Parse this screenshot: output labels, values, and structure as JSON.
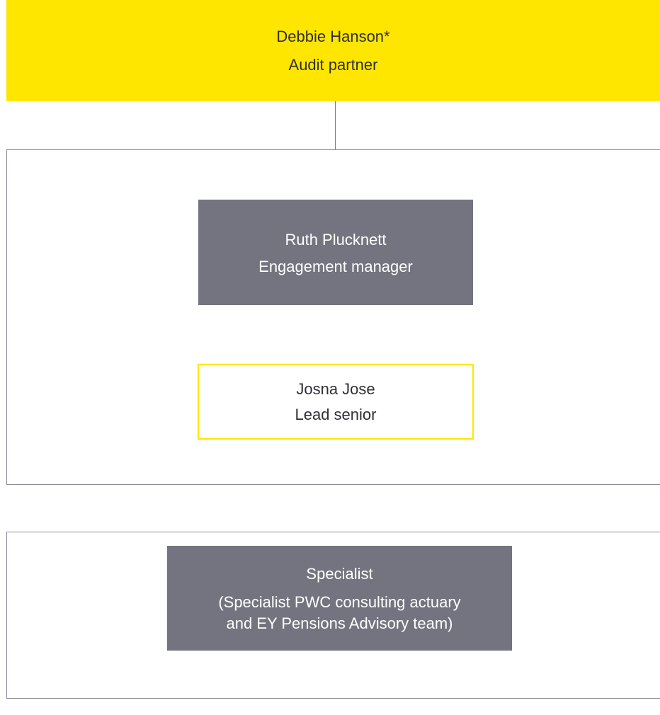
{
  "colors": {
    "partner_fill": "#FFE600",
    "manager_fill": "#747480",
    "senior_border": "#FFE600",
    "specialist_fill": "#747480",
    "frame_border": "#8A8A94",
    "connector": "#747480"
  },
  "partner": {
    "name": "Debbie Hanson*",
    "role": "Audit partner"
  },
  "manager": {
    "name": "Ruth Plucknett",
    "role": "Engagement manager"
  },
  "senior": {
    "name": "Josna Jose",
    "role": "Lead senior"
  },
  "specialist": {
    "title": "Specialist",
    "description_line1": "(Specialist PWC consulting actuary",
    "description_line2": "and EY Pensions Advisory team)"
  }
}
